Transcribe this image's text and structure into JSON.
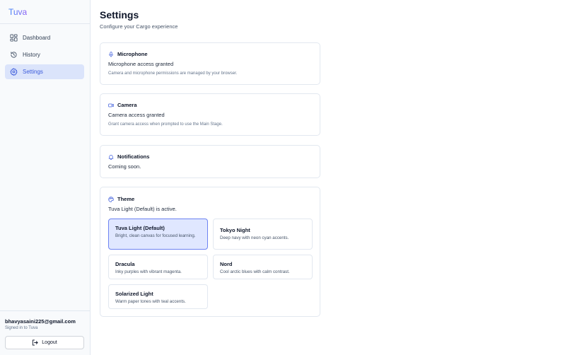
{
  "sidebar": {
    "brand": "Tuva",
    "nav": [
      {
        "label": "Dashboard",
        "icon": "dashboard-icon"
      },
      {
        "label": "History",
        "icon": "history-icon"
      },
      {
        "label": "Settings",
        "icon": "settings-gear-icon",
        "active": true
      }
    ],
    "user": {
      "email": "bhavyasaini225@gmail.com",
      "subtitle": "Signed in to Tuva"
    },
    "logout_label": "Logout"
  },
  "main": {
    "title": "Settings",
    "subtitle": "Configure your Cargo experience",
    "cards": {
      "microphone": {
        "title": "Microphone",
        "status": "Microphone access granted",
        "note": "Camera and microphone permissions are managed by your browser."
      },
      "camera": {
        "title": "Camera",
        "status": "Camera access granted",
        "note": "Grant camera access when prompted to use the Main Stage."
      },
      "notifications": {
        "title": "Notifications",
        "status": "Coming soon."
      },
      "theme": {
        "title": "Theme",
        "status": "Tuva Light (Default) is active.",
        "options": [
          {
            "name": "Tuva Light (Default)",
            "description": "Bright, clean canvas for focused learning.",
            "active": true
          },
          {
            "name": "Tokyo Night",
            "description": "Deep navy with neon cyan accents."
          },
          {
            "name": "Dracula",
            "description": "Inky purples with vibrant magenta."
          },
          {
            "name": "Nord",
            "description": "Cool arctic blues with calm contrast."
          },
          {
            "name": "Solarized Light",
            "description": "Warm paper tones with teal accents."
          }
        ]
      }
    }
  },
  "colors": {
    "accent": "#3b5bdb",
    "active_nav_bg": "#dbe4fb",
    "active_theme_bg": "#e0e7ff",
    "active_theme_border": "#6d83f2"
  }
}
